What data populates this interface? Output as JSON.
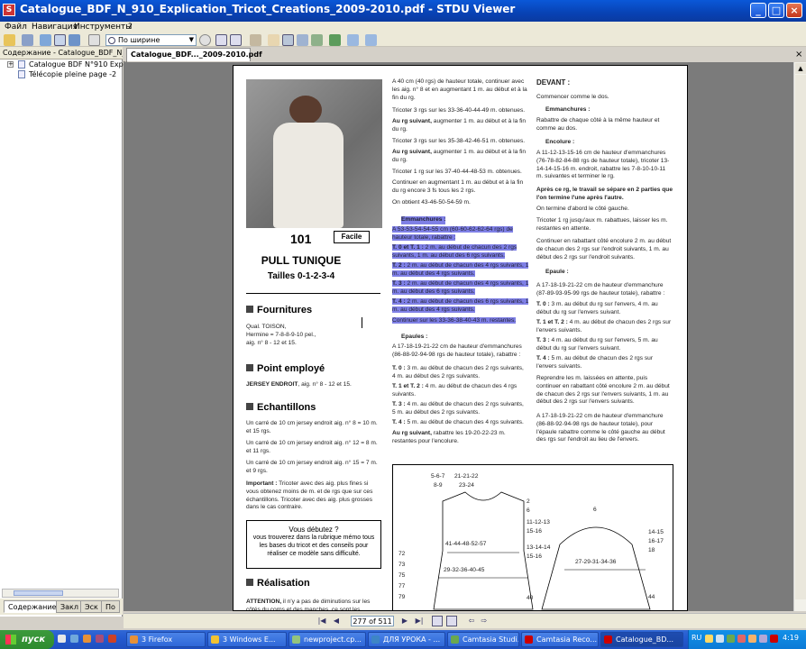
{
  "window": {
    "title": "Catalogue_BDF_N_910_Explication_Tricot_Creations_2009-2010.pdf - STDU Viewer",
    "app_icon": "S"
  },
  "menu": [
    "Файл",
    "Навигация",
    "Инструменты",
    "?"
  ],
  "toolbar": {
    "zoom_value": "По ширине"
  },
  "left_panel": {
    "header": "Содержание - Catalogue_BDF_N_91",
    "tree": [
      {
        "label": "Catalogue BDF N°910 Explica",
        "expander": "+"
      },
      {
        "label": "Télécopie pleine page -2",
        "expander": ""
      }
    ],
    "tabs": [
      "Содержание",
      "Закл",
      "Эск",
      "По"
    ]
  },
  "doc_tab": {
    "label": "Catalogue_BDF..._2009-2010.pdf",
    "close": "×"
  },
  "page": {
    "model_number": "101",
    "difficulty": "Facile",
    "title": "PULL TUNIQUE",
    "sizes": "Tailles 0-1-2-3-4",
    "fournitures_heading": "Fournitures",
    "fournitures_text": "Qual. TOISON,\nHermine = 7-8-8-9-10 pel.,\naig. n° 8 - 12 et 15.",
    "point_heading": "Point employé",
    "point_bold": "JERSEY ENDROIT",
    "point_text": ", aig. n° 8 - 12 et 15.",
    "echant_heading": "Echantillons",
    "echant_1": "Un carré de 10 cm jersey endroit aig. n° 8 = 10 m. et 15 rgs.",
    "echant_2": "Un carré de 10 cm jersey endroit aig. n° 12 = 8 m. et 11 rgs.",
    "echant_3": "Un carré de 10 cm jersey endroit aig. n° 15 = 7 m. et 9 rgs.",
    "important_bold": "Important :",
    "important_text": " Tricoter avec des aig. plus fines si vous obtenez moins de m. et de rgs que sur ces échantillons. Tricoter avec des aig. plus grosses dans le cas contraire.",
    "box_title": "Vous débutez ?",
    "box_text": "vous trouverez dans la rubrique mémo tous les bases du tricot et des conseils pour réaliser ce modèle sans difficulté.",
    "real_heading": "Réalisation",
    "attention_bold": "ATTENTION,",
    "attention_text": " il n'y a pas de diminutions sur les côtés du corps et des manches, ce sont les",
    "col2_p1": "A 40 cm (40 rgs) de hauteur totale, continuer avec les aig. n° 8 et en augmentant 1 m. au début et à la fin du rg.",
    "col2_p2": "Tricoter 3 rgs sur les 33-36-40-44-49 m. obtenues.",
    "col2_p3b": "Au rg suivant,",
    "col2_p3": " augmenter 1 m. au début et à la fin du rg.",
    "col2_p4": "Tricoter 3 rgs sur les 35-38-42-46-51 m. obtenues.",
    "col2_p5b": "Au rg suivant,",
    "col2_p5": " augmenter 1 m. au début et à la fin du rg.",
    "col2_p6": "Tricoter 1 rg sur les 37-40-44-48-53 m. obtenues.",
    "col2_p7": "Continuer en augmentant 1 m. au début et à la fin du rg encore 3 fs tous les 2 rgs.",
    "col2_p8": "On obtient 43-46-50-54-59 m.",
    "emm_heading": "Emmanchures :",
    "emm_1": "A 53-53-54-54-55 cm (60-60-62-62-64 rgs) de hauteur totale, rabattre :",
    "emm_2b": "T. 0 et T. 1 :",
    "emm_2": " 2 m. au début de chacun des 2 rgs suivants, 1 m. au début des 6 rgs suivants.",
    "emm_3b": "T. 2 :",
    "emm_3": " 2 m. au début de chacun des 4 rgs suivants, 1 m. au début des 4 rgs suivants.",
    "emm_4b": "T. 3 :",
    "emm_4": " 2 m. au début de chacun des 4 rgs suivants, 1 m. au début des 6 rgs suivants.",
    "emm_5b": "T. 4 :",
    "emm_5": " 2 m. au début de chacun des 6 rgs suivants, 1 m. au début des 4 rgs suivants.",
    "emm_6": "Continuer sur les 33-36-38-40-43 m. restantes.",
    "epaules_heading": "Epaules :",
    "ep_1": "A 17-18-19-21-22 cm de hauteur d'emmanchures (86-88-92-94-98 rgs de hauteur totale), rabattre :",
    "ep_2b": "T. 0 :",
    "ep_2": " 3 m. au début de chacun des 2 rgs suivants, 4 m. au début des 2 rgs suivants.",
    "ep_3b": "T. 1 et T. 2 :",
    "ep_3": " 4 m. au début de chacun des 4 rgs suivants.",
    "ep_4b": "T. 3 :",
    "ep_4": " 4 m. au début de chacun des 2 rgs suivants, 5 m. au début des 2 rgs suivants.",
    "ep_5b": "T. 4 :",
    "ep_5": " 5 m. au début de chacun des 4 rgs suivants.",
    "ep_6b": "Au rg suivant,",
    "ep_6": " rabattre les 19-20-22-23 m. restantes pour l'encolure.",
    "devant_heading": "DEVANT :",
    "dv_1": "Commencer comme le dos.",
    "dv_emm_heading": "Emmanchures :",
    "dv_2": "Rabattre de chaque côté à la même hauteur et comme au dos.",
    "dv_enc_heading": "Encolure :",
    "dv_3": "A 11-12-13-15-16 cm de hauteur d'emmanchures (76-78-82-84-88 rgs de hauteur totale), tricoter 13-14-14-15-16 m. endroit, rabattre les 7-8-10-10-11 m. suivantes et terminer le rg.",
    "dv_4": "Après ce rg, le travail se sépare en 2 parties que l'on termine l'une après l'autre.",
    "dv_5": "On termine d'abord le côté gauche.",
    "dv_6": "Tricoter 1 rg jusqu'aux m. rabattues, laisser les m. restantes en attente.",
    "dv_7": "Continuer en rabattant côté encolure 2 m. au début de chacun des 2 rgs sur l'endroit suivants, 1 m. au début des 2 rgs sur l'endroit suivants.",
    "dv_ep_heading": "Epaule :",
    "dv_8": "A 17-18-19-21-22 cm de hauteur d'emmanchure (87-89-93-95-99 rgs de hauteur totale), rabattre :",
    "dv_9b": "T. 0 :",
    "dv_9": " 3 m. au début du rg sur l'envers, 4 m. au début du rg sur l'envers suivant.",
    "dv_10b": "T. 1 et T. 2 :",
    "dv_10": " 4 m. au début de chacun des 2 rgs sur l'envers suivants.",
    "dv_11b": "T. 3 :",
    "dv_11": " 4 m. au début du rg sur l'envers, 5 m. au début du rg sur l'envers suivant.",
    "dv_12b": "T. 4 :",
    "dv_12": " 5 m. au début de chacun des 2 rgs sur l'envers suivants.",
    "dv_13": "Reprendre les m. laissées en attente, puis continuer en rabattant côté encolure 2 m. au début de chacun des 2 rgs sur l'envers suivants, 1 m. au début des 2 rgs sur l'envers suivants.",
    "dv_14": "A 17-18-19-21-22 cm de hauteur d'emmanchure (86-88-92-94-98 rgs de hauteur totale), pour l'épaule rabattre comme le côté gauche au début des rgs sur l'endroit au lieu de l'envers.",
    "diagram_labels": {
      "a": "5-6-7",
      "b": "8-9",
      "c": "21-21-22",
      "d": "23-24",
      "e": "2",
      "f": "6",
      "g": "11-12-13",
      "h": "15-16",
      "i": "41-44-48-52-57",
      "j": "13-14-14",
      "k": "15-16",
      "l": "29-32-36-40-45",
      "m": "72",
      "n": "73",
      "o": "75",
      "p": "77",
      "q": "79",
      "r": "40",
      "s": "6",
      "t": "14-15",
      "u": "16-17",
      "v": "18",
      "w": "27-29-31-34-36",
      "x": "44"
    }
  },
  "nav": {
    "page_counter": "277 of 511"
  },
  "taskbar": {
    "start": "пуск",
    "tasks": [
      "3 Firefox",
      "3 Windows E...",
      "newproject.cp...",
      "ДЛЯ УРОКА - ...",
      "Camtasia Studi...",
      "Camtasia Reco...",
      "Catalogue_BD..."
    ],
    "lang": "RU",
    "clock": "4:19"
  }
}
